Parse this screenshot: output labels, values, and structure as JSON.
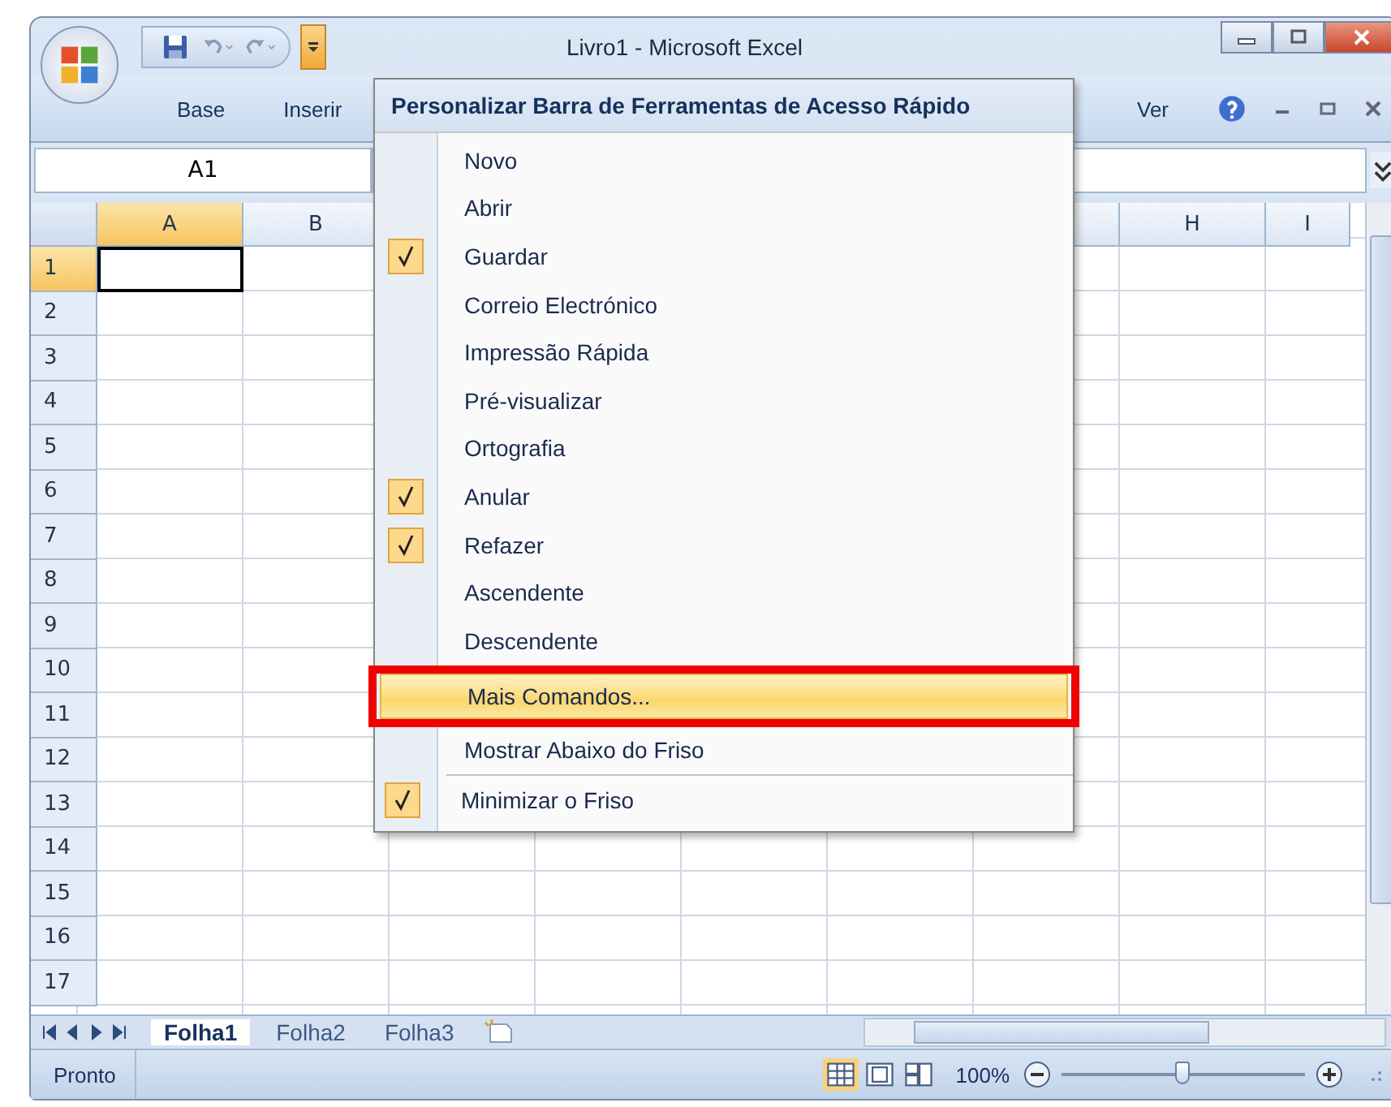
{
  "window": {
    "title": "Livro1 - Microsoft Excel"
  },
  "ribbon_tabs": [
    {
      "label": "Base",
      "selected": false
    },
    {
      "label": "Inserir",
      "selected": false
    },
    {
      "label": "Ver",
      "selected": false
    }
  ],
  "name_box": "A1",
  "sheet": {
    "columns": [
      {
        "label": "A",
        "selected": true
      },
      {
        "label": "B",
        "selected": false
      },
      {
        "label": "H",
        "selected": false
      },
      {
        "label": "I",
        "selected": false
      }
    ],
    "rows": [
      {
        "label": "1",
        "selected": true
      },
      {
        "label": "2",
        "selected": false
      },
      {
        "label": "3",
        "selected": false
      },
      {
        "label": "4",
        "selected": false
      },
      {
        "label": "5",
        "selected": false
      },
      {
        "label": "6",
        "selected": false
      },
      {
        "label": "7",
        "selected": false
      },
      {
        "label": "8",
        "selected": false
      },
      {
        "label": "9",
        "selected": false
      },
      {
        "label": "10",
        "selected": false
      },
      {
        "label": "11",
        "selected": false
      },
      {
        "label": "12",
        "selected": false
      },
      {
        "label": "13",
        "selected": false
      },
      {
        "label": "14",
        "selected": false
      },
      {
        "label": "15",
        "selected": false
      },
      {
        "label": "16",
        "selected": false
      },
      {
        "label": "17",
        "selected": false
      }
    ]
  },
  "menu": {
    "title": "Personalizar Barra de Ferramentas de Acesso Rápido",
    "groups": [
      {
        "items": [
          {
            "label": "Novo",
            "checked": false,
            "highlighted": false,
            "annotated": false
          },
          {
            "label": "Abrir",
            "checked": false,
            "highlighted": false,
            "annotated": false
          },
          {
            "label": "Guardar",
            "checked": true,
            "highlighted": false,
            "annotated": false
          },
          {
            "label": "Correio Electrónico",
            "checked": false,
            "highlighted": false,
            "annotated": false
          },
          {
            "label": "Impressão Rápida",
            "checked": false,
            "highlighted": false,
            "annotated": false
          },
          {
            "label": "Pré-visualizar",
            "checked": false,
            "highlighted": false,
            "annotated": false
          },
          {
            "label": "Ortografia",
            "checked": false,
            "highlighted": false,
            "annotated": false
          },
          {
            "label": "Anular",
            "checked": true,
            "highlighted": false,
            "annotated": false
          },
          {
            "label": "Refazer",
            "checked": true,
            "highlighted": false,
            "annotated": false
          },
          {
            "label": "Ascendente",
            "checked": false,
            "highlighted": false,
            "annotated": false
          },
          {
            "label": "Descendente",
            "checked": false,
            "highlighted": false,
            "annotated": false
          },
          {
            "label": "Mais Comandos...",
            "checked": false,
            "highlighted": true,
            "annotated": true
          },
          {
            "label": "Mostrar Abaixo do Friso",
            "checked": false,
            "highlighted": false,
            "annotated": false
          }
        ]
      },
      {
        "items": [
          {
            "label": "Minimizar o Friso",
            "checked": true,
            "highlighted": false,
            "annotated": false
          }
        ]
      }
    ]
  },
  "sheet_tabs": [
    {
      "label": "Folha1",
      "selected": true
    },
    {
      "label": "Folha2",
      "selected": false
    },
    {
      "label": "Folha3",
      "selected": false
    }
  ],
  "status_bar": {
    "text": "Pronto",
    "views": [
      {
        "selected": true
      },
      {
        "selected": false
      },
      {
        "selected": false
      }
    ],
    "zoom": "100%",
    "zoom_slider": {
      "level": 0.5
    }
  }
}
